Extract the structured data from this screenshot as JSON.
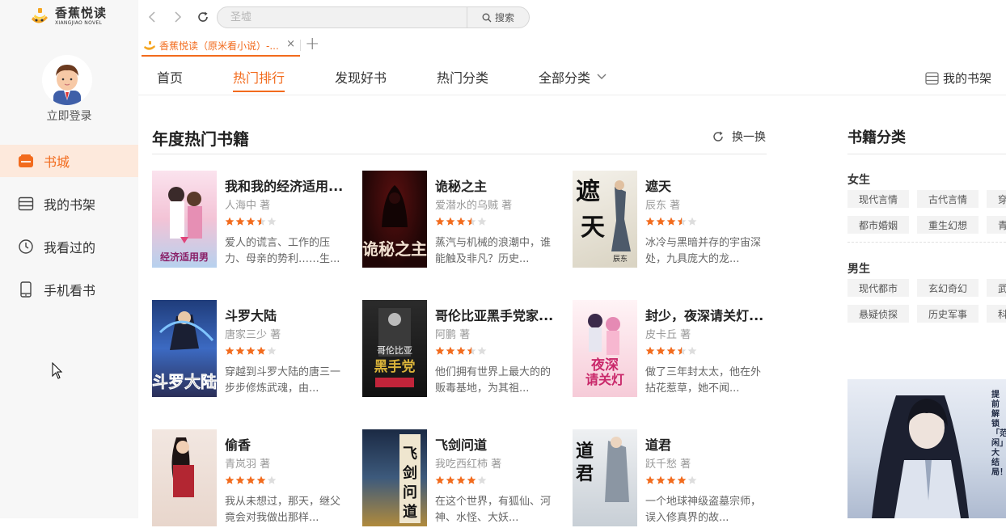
{
  "app": {
    "logo_cn": "香蕉悦读",
    "logo_en": "XIANGJIAO NOVEL",
    "login_label": "立即登录"
  },
  "sidebar": {
    "items": [
      {
        "label": "书城",
        "icon": "store-icon",
        "active": true
      },
      {
        "label": "我的书架",
        "icon": "bookshelf-icon",
        "active": false
      },
      {
        "label": "我看过的",
        "icon": "clock-icon",
        "active": false
      },
      {
        "label": "手机看书",
        "icon": "phone-icon",
        "active": false
      }
    ]
  },
  "toolbar": {
    "search_placeholder": "圣墟",
    "search_button": "搜索"
  },
  "tab": {
    "title": "香蕉悦读（原米看小说）-...",
    "close": "×",
    "add": "+"
  },
  "mainnav": {
    "tabs": [
      "首页",
      "热门排行",
      "发现好书",
      "热门分类",
      "全部分类"
    ],
    "active_index": 1,
    "shelf": "我的书架"
  },
  "section": {
    "title": "年度热门书籍",
    "refresh": "换一换"
  },
  "books": [
    {
      "title": "我和我的经济适用...",
      "author": "人海中 著",
      "rating": 3.5,
      "desc": "爱人的谎言、工作的压力、母亲的势利……生..."
    },
    {
      "title": "诡秘之主",
      "author": "爱潜水的乌贼 著",
      "rating": 3.5,
      "desc": "蒸汽与机械的浪潮中，谁能触及非凡？历史..."
    },
    {
      "title": "遮天",
      "author": "辰东 著",
      "rating": 3.5,
      "desc": "冰冷与黑暗并存的宇宙深处，九具庞大的龙..."
    },
    {
      "title": "斗罗大陆",
      "author": "唐家三少 著",
      "rating": 4,
      "desc": "穿越到斗罗大陆的唐三一步步修炼武魂，由..."
    },
    {
      "title": "哥伦比亚黑手党家...",
      "author": "阿鹏 著",
      "rating": 3.5,
      "desc": "他们拥有世界上最大的的贩毒基地，为其祖..."
    },
    {
      "title": "封少，夜深请关灯...",
      "author": "皮卡丘 著",
      "rating": 3.5,
      "desc": "做了三年封太太，他在外拈花惹草，她不闻..."
    },
    {
      "title": "偷香",
      "author": "青岚羽 著",
      "rating": 4,
      "desc": "我从未想过，那天，继父竟会对我做出那样..."
    },
    {
      "title": "飞剑问道",
      "author": "我吃西红柿 著",
      "rating": 4,
      "desc": "在这个世界，有狐仙、河神、水怪、大妖..."
    },
    {
      "title": "道君",
      "author": "跃千愁 著",
      "rating": 4,
      "desc": "一个地球神级盗墓宗师，误入修真界的故..."
    }
  ],
  "categories": {
    "title": "书籍分类",
    "female": {
      "label": "女生",
      "tags": [
        "现代言情",
        "古代言情",
        "穿",
        "都市婚姻",
        "重生幻想",
        "青"
      ]
    },
    "male": {
      "label": "男生",
      "tags": [
        "现代都市",
        "玄幻奇幻",
        "武",
        "悬疑侦探",
        "历史军事",
        "科"
      ]
    }
  },
  "banner": {
    "text": "提前解锁「范闲」大结局！"
  },
  "colors": {
    "accent": "#f26b1d",
    "star": "#f26b1d",
    "star_empty": "#dddddd",
    "sidebar_active_bg": "#fde9dc"
  }
}
